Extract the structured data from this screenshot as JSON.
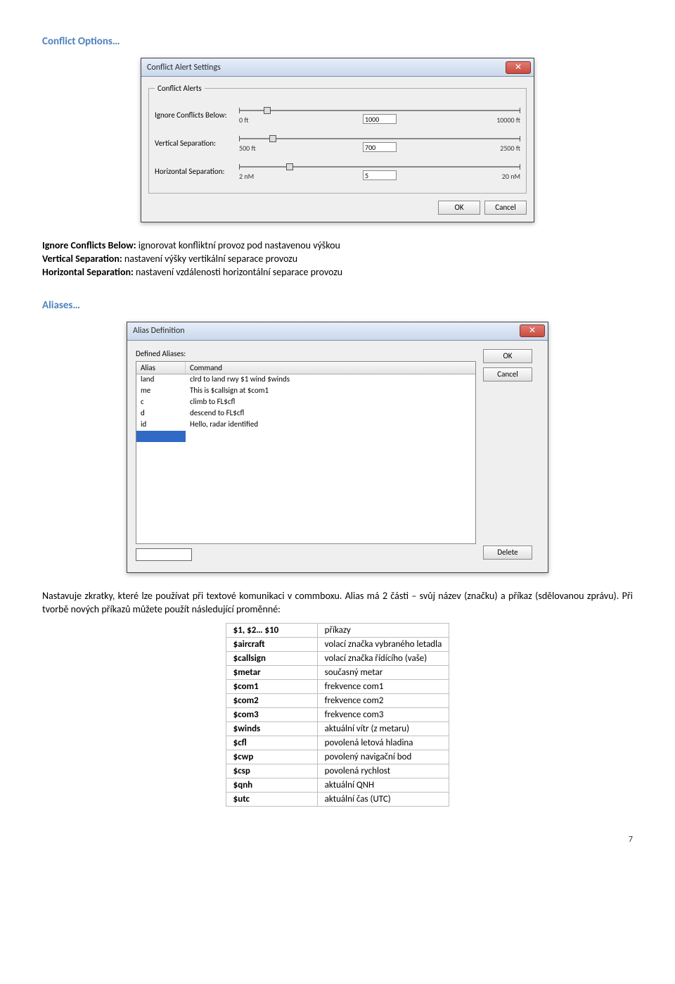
{
  "headings": {
    "conflict_options": "Conflict Options…",
    "aliases": "Aliases…"
  },
  "conflict_window": {
    "title": "Conflict Alert Settings",
    "fieldset_legend": "Conflict Alerts",
    "rows": [
      {
        "label": "Ignore Conflicts Below:",
        "min": "0 ft",
        "max": "10000 ft",
        "value": "1000",
        "thumb_pct": 10
      },
      {
        "label": "Vertical Separation:",
        "min": "500 ft",
        "max": "2500 ft",
        "value": "700",
        "thumb_pct": 12
      },
      {
        "label": "Horizontal Separation:",
        "min": "2 nM",
        "max": "20 nM",
        "value": "5",
        "thumb_pct": 18
      }
    ],
    "ok": "OK",
    "cancel": "Cancel"
  },
  "alias_window": {
    "title": "Alias Definition",
    "defined_label": "Defined Aliases:",
    "col1": "Alias",
    "col2": "Command",
    "rows": [
      {
        "alias": "land",
        "command": "clrd to land rwy $1 wind $winds"
      },
      {
        "alias": "me",
        "command": "This is $callsign at $com1"
      },
      {
        "alias": "c",
        "command": "climb to FL$cfl"
      },
      {
        "alias": "d",
        "command": "descend to FL$cfl"
      },
      {
        "alias": "id",
        "command": "Hello, radar identified"
      }
    ],
    "ok": "OK",
    "cancel": "Cancel",
    "delete": "Delete"
  },
  "body": {
    "p1a": "Ignore Conflicts Below:",
    "p1b": " ignorovat konfliktní provoz pod nastavenou výškou",
    "p2a": "Vertical Separation:",
    "p2b": " nastavení výšky vertikální separace provozu",
    "p3a": "Horizontal Separation:",
    "p3b": " nastavení vzdálenosti horizontální separace provozu",
    "alias_text": "Nastavuje zkratky, které lze používat při textové komunikaci v commboxu. Alias má 2 části – svůj název (značku) a příkaz (sdělovanou zprávu). Při tvorbě nových příkazů můžete použít následující proměnné:"
  },
  "vars": [
    {
      "k": "$1, $2… $10",
      "v": "příkazy"
    },
    {
      "k": "$aircraft",
      "v": "volací značka vybraného letadla"
    },
    {
      "k": "$callsign",
      "v": "volací značka řídícího (vaše)"
    },
    {
      "k": "$metar",
      "v": "současný metar"
    },
    {
      "k": "$com1",
      "v": "frekvence com1"
    },
    {
      "k": "$com2",
      "v": "frekvence com2"
    },
    {
      "k": "$com3",
      "v": "frekvence com3"
    },
    {
      "k": "$winds",
      "v": "aktuální vítr (z metaru)"
    },
    {
      "k": "$cfl",
      "v": "povolená letová hladina"
    },
    {
      "k": "$cwp",
      "v": "povolený navigační bod"
    },
    {
      "k": "$csp",
      "v": "povolená rychlost"
    },
    {
      "k": "$qnh",
      "v": "aktuální QNH"
    },
    {
      "k": "$utc",
      "v": "aktuální čas (UTC)"
    }
  ],
  "page_number": "7"
}
